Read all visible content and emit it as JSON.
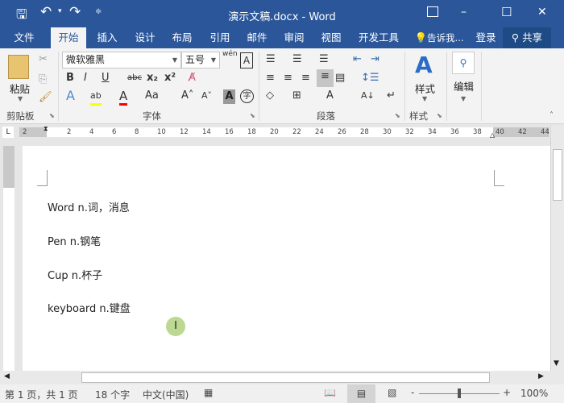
{
  "title": "演示文稿.docx - Word",
  "qat": {
    "save": "save-icon",
    "undo": "undo-icon",
    "redo": "redo-icon",
    "customize": "customize-icon"
  },
  "window": {
    "ribbon_display": "ribbon-display-icon",
    "minimize": "–",
    "maximize": "☐",
    "close": "✕"
  },
  "tabs": [
    "文件",
    "开始",
    "插入",
    "设计",
    "布局",
    "引用",
    "邮件",
    "审阅",
    "视图",
    "开发工具"
  ],
  "active_tab": "开始",
  "tell_me": "告诉我...",
  "login": "登录",
  "share": "共享",
  "ribbon": {
    "clipboard": {
      "paste": "粘贴",
      "label": "剪贴板"
    },
    "font": {
      "name": "微软雅黑",
      "size": "五号",
      "label": "字体",
      "bold": "B",
      "italic": "I",
      "underline": "U",
      "strike": "abc",
      "sub": "x₂",
      "sup": "x²",
      "phonetic": "wén",
      "border": "A",
      "grow": "A˄",
      "shrink": "A˅",
      "case": "Aa",
      "shade": "A",
      "enclose": "字"
    },
    "paragraph": {
      "label": "段落"
    },
    "styles": {
      "button": "样式",
      "label": "样式"
    },
    "editing": {
      "button": "编辑"
    }
  },
  "ruler": {
    "ticks": [
      "2",
      "2",
      "4",
      "6",
      "8",
      "10",
      "12",
      "14",
      "16",
      "18",
      "20",
      "22",
      "24",
      "26",
      "28",
      "30",
      "32",
      "34",
      "36",
      "38",
      "40",
      "42",
      "44"
    ],
    "tab_selector": "L"
  },
  "document": {
    "lines": [
      "Word n.词，消息",
      "Pen n.钢笔",
      "Cup n.杯子",
      "keyboard n.键盘"
    ]
  },
  "status": {
    "page": "第 1 页，共 1 页",
    "words": "18 个字",
    "language": "中文(中国)",
    "zoom": "100%",
    "zoom_minus": "-",
    "zoom_plus": "+",
    "zoom_level_percent": 100
  },
  "colors": {
    "brand": "#2b579a",
    "ribbon": "#f3f3f3",
    "highlight": "#ffff00",
    "font_color": "#ff0000"
  }
}
